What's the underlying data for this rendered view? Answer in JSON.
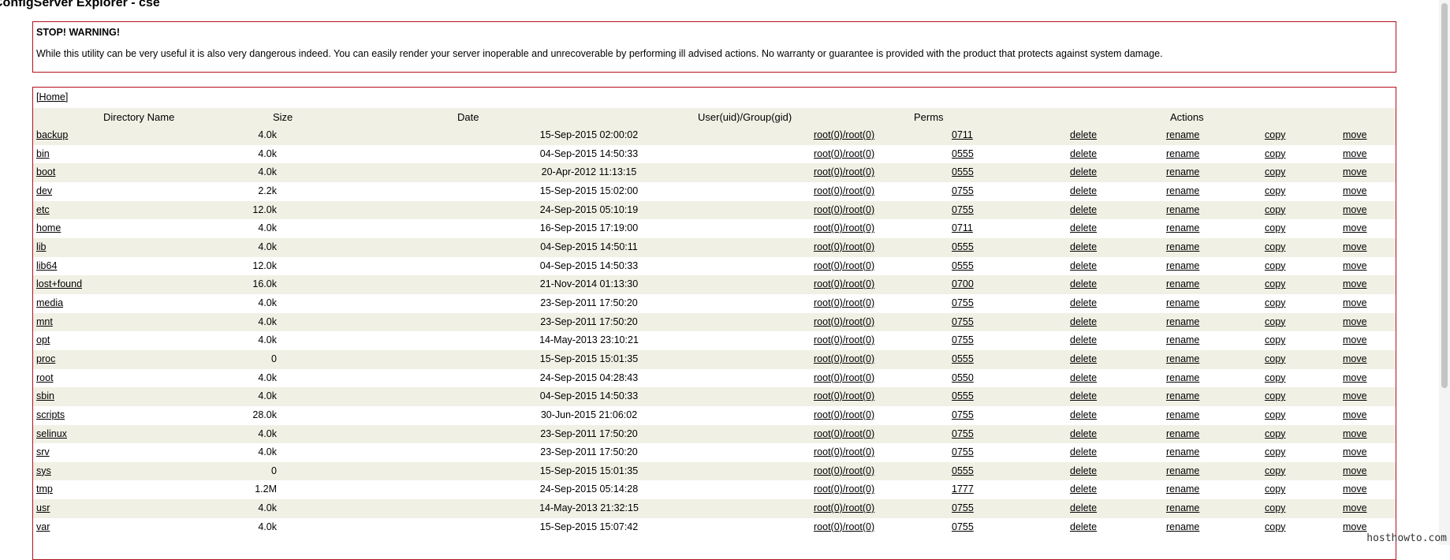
{
  "app": {
    "title": "ConfigServer Explorer - cse"
  },
  "warning": {
    "title": "STOP! WARNING!",
    "text": "While this utility can be very useful it is also very dangerous indeed. You can easily render your server inoperable and unrecoverable by performing ill advised actions. No warranty or guarantee is provided with the product that protects against system damage."
  },
  "nav": {
    "home_label": "[Home]"
  },
  "table": {
    "headers": {
      "name": "Directory Name",
      "size": "Size",
      "date": "Date",
      "owner": "User(uid)/Group(gid)",
      "perms": "Perms",
      "actions": "Actions"
    },
    "action_labels": {
      "delete": "delete",
      "rename": "rename",
      "copy": "copy",
      "move": "move"
    },
    "rows": [
      {
        "name": "backup",
        "size": "4.0k",
        "date": "15-Sep-2015 02:00:02",
        "owner": "root(0)/root(0)",
        "perms": "0711"
      },
      {
        "name": "bin",
        "size": "4.0k",
        "date": "04-Sep-2015 14:50:33",
        "owner": "root(0)/root(0)",
        "perms": "0555"
      },
      {
        "name": "boot",
        "size": "4.0k",
        "date": "20-Apr-2012 11:13:15",
        "owner": "root(0)/root(0)",
        "perms": "0555"
      },
      {
        "name": "dev",
        "size": "2.2k",
        "date": "15-Sep-2015 15:02:00",
        "owner": "root(0)/root(0)",
        "perms": "0755"
      },
      {
        "name": "etc",
        "size": "12.0k",
        "date": "24-Sep-2015 05:10:19",
        "owner": "root(0)/root(0)",
        "perms": "0755"
      },
      {
        "name": "home",
        "size": "4.0k",
        "date": "16-Sep-2015 17:19:00",
        "owner": "root(0)/root(0)",
        "perms": "0711"
      },
      {
        "name": "lib",
        "size": "4.0k",
        "date": "04-Sep-2015 14:50:11",
        "owner": "root(0)/root(0)",
        "perms": "0555"
      },
      {
        "name": "lib64",
        "size": "12.0k",
        "date": "04-Sep-2015 14:50:33",
        "owner": "root(0)/root(0)",
        "perms": "0555"
      },
      {
        "name": "lost+found",
        "size": "16.0k",
        "date": "21-Nov-2014 01:13:30",
        "owner": "root(0)/root(0)",
        "perms": "0700"
      },
      {
        "name": "media",
        "size": "4.0k",
        "date": "23-Sep-2011 17:50:20",
        "owner": "root(0)/root(0)",
        "perms": "0755"
      },
      {
        "name": "mnt",
        "size": "4.0k",
        "date": "23-Sep-2011 17:50:20",
        "owner": "root(0)/root(0)",
        "perms": "0755"
      },
      {
        "name": "opt",
        "size": "4.0k",
        "date": "14-May-2013 23:10:21",
        "owner": "root(0)/root(0)",
        "perms": "0755"
      },
      {
        "name": "proc",
        "size": "0",
        "date": "15-Sep-2015 15:01:35",
        "owner": "root(0)/root(0)",
        "perms": "0555"
      },
      {
        "name": "root",
        "size": "4.0k",
        "date": "24-Sep-2015 04:28:43",
        "owner": "root(0)/root(0)",
        "perms": "0550"
      },
      {
        "name": "sbin",
        "size": "4.0k",
        "date": "04-Sep-2015 14:50:33",
        "owner": "root(0)/root(0)",
        "perms": "0555"
      },
      {
        "name": "scripts",
        "size": "28.0k",
        "date": "30-Jun-2015 21:06:02",
        "owner": "root(0)/root(0)",
        "perms": "0755"
      },
      {
        "name": "selinux",
        "size": "4.0k",
        "date": "23-Sep-2011 17:50:20",
        "owner": "root(0)/root(0)",
        "perms": "0755"
      },
      {
        "name": "srv",
        "size": "4.0k",
        "date": "23-Sep-2011 17:50:20",
        "owner": "root(0)/root(0)",
        "perms": "0755"
      },
      {
        "name": "sys",
        "size": "0",
        "date": "15-Sep-2015 15:01:35",
        "owner": "root(0)/root(0)",
        "perms": "0555"
      },
      {
        "name": "tmp",
        "size": "1.2M",
        "date": "24-Sep-2015 05:14:28",
        "owner": "root(0)/root(0)",
        "perms": "1777"
      },
      {
        "name": "usr",
        "size": "4.0k",
        "date": "14-May-2013 21:32:15",
        "owner": "root(0)/root(0)",
        "perms": "0755"
      },
      {
        "name": "var",
        "size": "4.0k",
        "date": "15-Sep-2015 15:07:42",
        "owner": "root(0)/root(0)",
        "perms": "0755"
      }
    ]
  },
  "watermark": "hosthowto.com",
  "colors": {
    "border": "#b30f1e",
    "row_alt": "#f1f0e5"
  }
}
